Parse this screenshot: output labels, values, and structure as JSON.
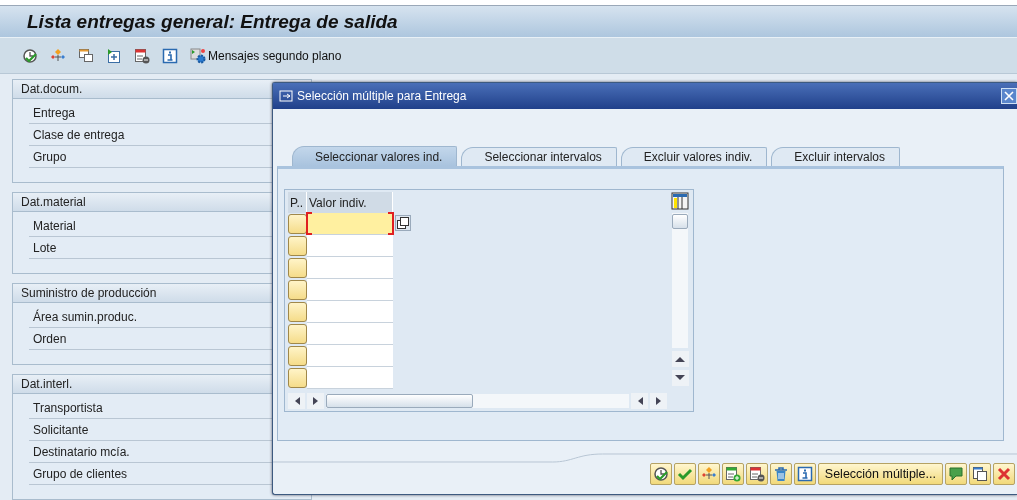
{
  "window": {
    "title": "Lista entregas general: Entrega de salida"
  },
  "toolbar": [
    {
      "kind": "execute"
    },
    {
      "kind": "hierarchy"
    },
    {
      "kind": "windows"
    },
    {
      "kind": "insert"
    },
    {
      "kind": "delete-row"
    },
    {
      "kind": "info"
    },
    {
      "kind": "jobs",
      "label": "Mensajes segundo plano"
    }
  ],
  "groups": [
    {
      "title": "Dat.docum.",
      "fields": [
        "Entrega",
        "Clase de entrega",
        "Grupo"
      ]
    },
    {
      "title": "Dat.material",
      "fields": [
        "Material",
        "Lote"
      ]
    },
    {
      "title": "Suministro de producción",
      "fields": [
        "Área sumin.produc.",
        "Orden"
      ]
    },
    {
      "title": "Dat.interl.",
      "fields": [
        "Transportista",
        "Solicitante",
        "Destinatario mcía.",
        "Grupo de clientes"
      ]
    }
  ],
  "dialog": {
    "title": "Selección múltiple para Entrega",
    "tabs": [
      {
        "label": "Seleccionar valores ind.",
        "selected": true
      },
      {
        "label": "Seleccionar intervalos",
        "selected": false
      },
      {
        "label": "Excluir valores indiv.",
        "selected": false
      },
      {
        "label": "Excluir intervalos",
        "selected": false
      }
    ],
    "table": {
      "columns": [
        "P..",
        "Valor indiv."
      ],
      "rows": [
        {
          "focused": true
        },
        {
          "focused": false
        },
        {
          "focused": false
        },
        {
          "focused": false
        },
        {
          "focused": false
        },
        {
          "focused": false
        },
        {
          "focused": false
        },
        {
          "focused": false
        }
      ]
    },
    "buttons": [
      {
        "kind": "execute"
      },
      {
        "kind": "check"
      },
      {
        "kind": "hierarchy"
      },
      {
        "kind": "insert-row"
      },
      {
        "kind": "delete-row"
      },
      {
        "kind": "trash"
      },
      {
        "kind": "info"
      },
      {
        "kind": "text",
        "label": "Selección múltiple..."
      },
      {
        "kind": "comment"
      },
      {
        "kind": "copy"
      },
      {
        "kind": "cancel"
      }
    ]
  }
}
